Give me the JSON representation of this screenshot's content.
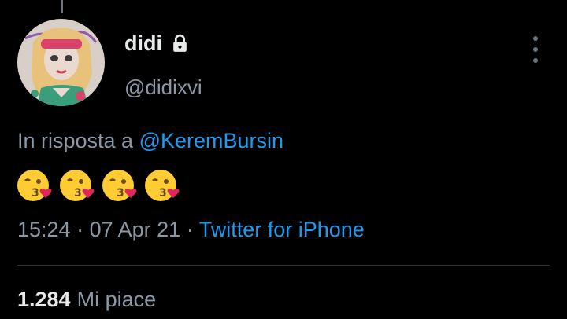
{
  "tweet": {
    "display_name": "didi",
    "handle": "@didixvi",
    "reply_prefix": "In risposta a",
    "reply_to": "@KeremBursin",
    "emoji": [
      "kissing-face-with-heart",
      "kissing-face-with-heart",
      "kissing-face-with-heart",
      "kissing-face-with-heart"
    ],
    "time": "15:24",
    "separator": "·",
    "date": "07 Apr 21",
    "source": "Twitter for iPhone",
    "likes_count": "1.284",
    "likes_label": "Mi piace"
  },
  "icons": {
    "lock": "lock-icon",
    "more": "more-vertical-icon"
  },
  "colors": {
    "background": "#000000",
    "link": "#1d9bf0",
    "secondary_text": "#8b98a5",
    "primary_text": "#e7e9ea",
    "divider": "#2f3336"
  }
}
